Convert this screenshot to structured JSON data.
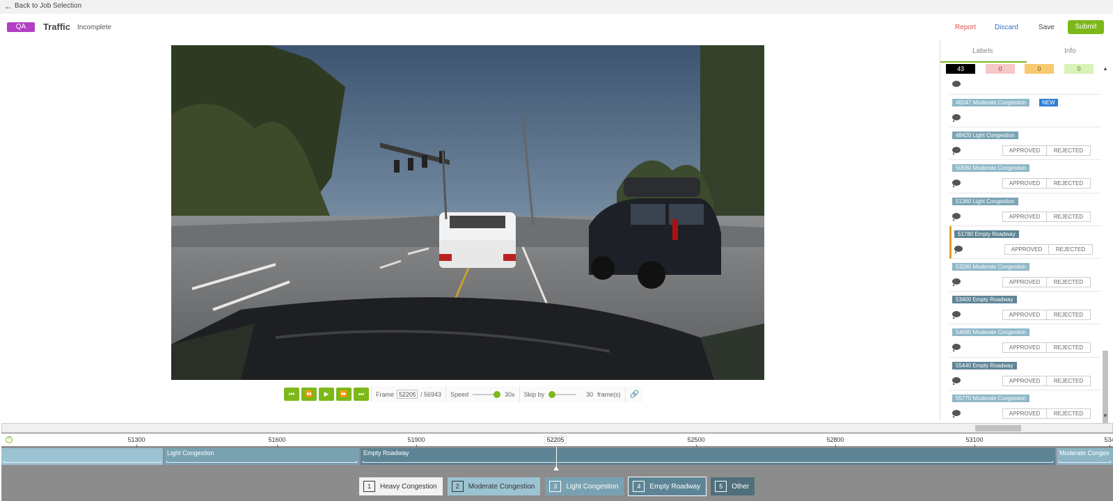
{
  "nav": {
    "back_label": "Back to Job Selection"
  },
  "header": {
    "badge": "QA",
    "title": "Traffic",
    "status": "Incomplete",
    "report": "Report",
    "discard": "Discard",
    "save": "Save",
    "submit": "Submit"
  },
  "player": {
    "frame_label": "Frame",
    "frame_value": "52205",
    "frame_total": "/ 56943",
    "speed_label": "Speed",
    "speed_value": "30x",
    "skip_label": "Skip by",
    "skip_value": "30",
    "skip_unit": "frame(s)"
  },
  "panel": {
    "tabs": [
      "Labels",
      "Info"
    ],
    "counts": [
      {
        "value": "43",
        "bg": "#000000",
        "fg": "#ffffff"
      },
      {
        "value": "0",
        "bg": "#f6c7c7",
        "fg": "#b03030"
      },
      {
        "value": "0",
        "bg": "#f7c970",
        "fg": "#7a5a10"
      },
      {
        "value": "0",
        "bg": "#d8f2b8",
        "fg": "#4a7a20"
      }
    ],
    "approve_label": "APPROVED",
    "reject_label": "REJECTED",
    "new_label": "NEW",
    "items": [
      {
        "label": "46247 Moderate Congestion",
        "color": "#8fb8c8",
        "is_new": true,
        "has_buttons": false,
        "active": false
      },
      {
        "label": "48420 Light Congestion",
        "color": "#7aa4b4",
        "is_new": false,
        "has_buttons": true,
        "active": false
      },
      {
        "label": "50580 Moderate Congestion",
        "color": "#8fb8c8",
        "is_new": false,
        "has_buttons": true,
        "active": false
      },
      {
        "label": "51360 Light Congestion",
        "color": "#7aa4b4",
        "is_new": false,
        "has_buttons": true,
        "active": false
      },
      {
        "label": "51780 Empty Roadway",
        "color": "#5f8596",
        "is_new": false,
        "has_buttons": true,
        "active": true
      },
      {
        "label": "53280 Moderate Congestion",
        "color": "#8fb8c8",
        "is_new": false,
        "has_buttons": true,
        "active": false
      },
      {
        "label": "53400 Empty Roadway",
        "color": "#5f8596",
        "is_new": false,
        "has_buttons": true,
        "active": false
      },
      {
        "label": "54690 Moderate Congestion",
        "color": "#8fb8c8",
        "is_new": false,
        "has_buttons": true,
        "active": false
      },
      {
        "label": "55440 Empty Roadway",
        "color": "#5f8596",
        "is_new": false,
        "has_buttons": true,
        "active": false
      },
      {
        "label": "55770 Moderate Congestion",
        "color": "#8fb8c8",
        "is_new": false,
        "has_buttons": true,
        "active": false
      }
    ]
  },
  "timeline": {
    "ticks": [
      "51300",
      "51600",
      "51900",
      "52500",
      "52800",
      "53100",
      "534"
    ],
    "current_frame": "52205",
    "segments": [
      {
        "label": "",
        "color": "#9cc3d1"
      },
      {
        "label": "Light Congestion",
        "color": "#78a2b2"
      },
      {
        "label": "Empty Roadway",
        "color": "#5d8495"
      },
      {
        "label": "Moderate Conges",
        "color": "#8cb6c6"
      }
    ],
    "legend": [
      {
        "num": "1",
        "label": "Heavy Congestion",
        "bg": "#f2f2f2",
        "fg": "#333333"
      },
      {
        "num": "2",
        "label": "Moderate Congestion",
        "bg": "#9cc3d1",
        "fg": "#333333"
      },
      {
        "num": "3",
        "label": "Light Congestion",
        "bg": "#78a2b2",
        "fg": "#ffffff"
      },
      {
        "num": "4",
        "label": "Empty Roadway",
        "bg": "#5d8495",
        "fg": "#ffffff"
      },
      {
        "num": "5",
        "label": "Other",
        "bg": "#4f6f7c",
        "fg": "#ffffff"
      }
    ]
  }
}
